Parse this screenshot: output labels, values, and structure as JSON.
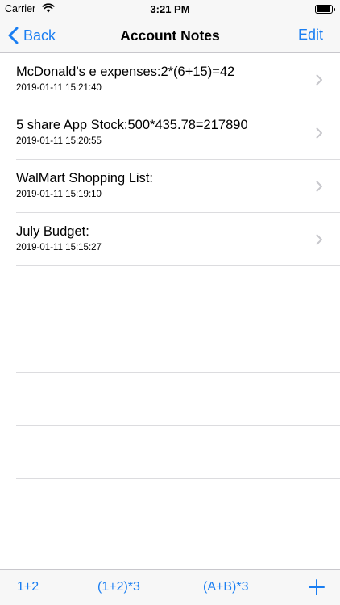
{
  "status_bar": {
    "carrier": "Carrier",
    "time": "3:21 PM",
    "battery_level": 0.95
  },
  "nav": {
    "back_label": "Back",
    "title": "Account Notes",
    "edit_label": "Edit"
  },
  "notes": [
    {
      "title": "McDonald’s e expenses:2*(6+15)=42",
      "date": "2019-01-11 15:21:40"
    },
    {
      "title": "5 share App Stock:500*435.78=217890",
      "date": "2019-01-11 15:20:55"
    },
    {
      "title": "WalMart Shopping List:",
      "date": "2019-01-11 15:19:10"
    },
    {
      "title": "July Budget:",
      "date": "2019-01-11 15:15:27"
    }
  ],
  "toolbar": {
    "btn1": "1+2",
    "btn2": "(1+2)*3",
    "btn3": "(A+B)*3",
    "add_icon": "plus-icon"
  },
  "colors": {
    "accent": "#1a7ef2",
    "bar_bg": "#f7f7f7",
    "separator": "#dcdcdf"
  }
}
